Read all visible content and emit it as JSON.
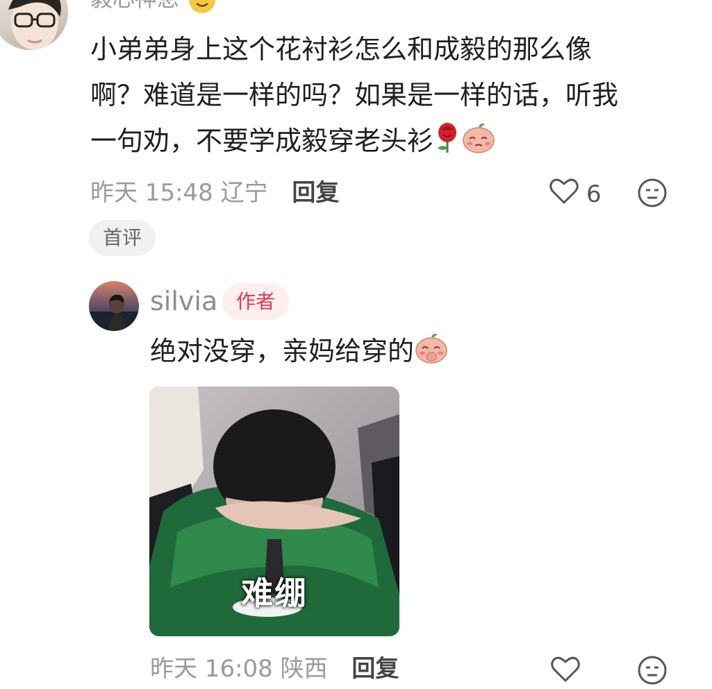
{
  "comment": {
    "username": "毅心神息",
    "text_line1": "小弟弟身上这个花衬衫怎么和成毅的那么像",
    "text_line2": "啊？难道是一样的吗？如果是一样的话，听我",
    "text_line3": "一句劝，不要学成毅穿老头衫",
    "time": "昨天 15:48",
    "location": "辽宁",
    "reply_label": "回复",
    "like_count": "6",
    "tag": "首评"
  },
  "reply": {
    "username": "silvia",
    "author_badge": "作者",
    "text": "绝对没穿，亲妈给穿的",
    "image_caption": "难绷",
    "time": "昨天 16:08",
    "location": "陕西",
    "reply_label": "回复"
  },
  "colors": {
    "meta_gray": "#9a9a9a",
    "author_red": "#e3384f",
    "author_bg": "#fdeef0",
    "tag_bg": "#f1f1f1"
  },
  "icons": [
    "smile-emoji-icon",
    "rose-emoji-icon",
    "peach-face-emoji-icon",
    "heart-outline-icon",
    "dislike-face-icon"
  ]
}
